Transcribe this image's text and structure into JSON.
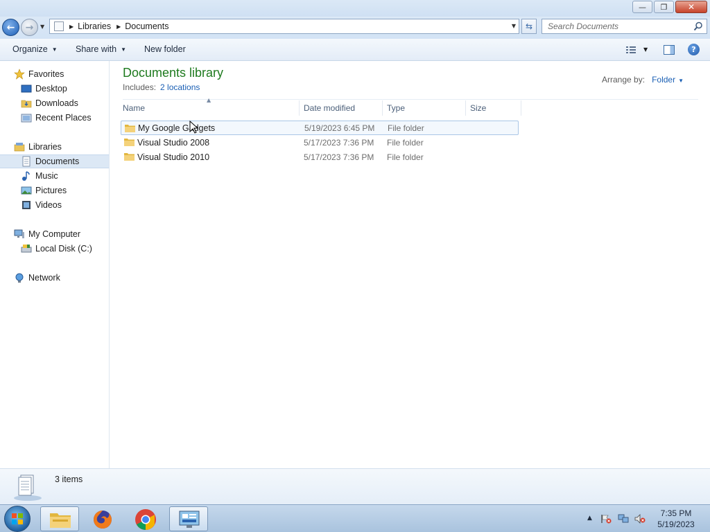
{
  "window": {
    "minimize_glyph": "—",
    "maximize_glyph": "❐",
    "close_glyph": "✕"
  },
  "address": {
    "back_glyph": "←",
    "forward_glyph": "→",
    "breadcrumbs": [
      "Libraries",
      "Documents"
    ],
    "search_placeholder": "Search Documents"
  },
  "toolbar": {
    "organize_label": "Organize",
    "share_label": "Share with",
    "new_folder_label": "New folder",
    "help_glyph": "?"
  },
  "nav": {
    "favorites": "Favorites",
    "desktop": "Desktop",
    "downloads": "Downloads",
    "recent_places": "Recent Places",
    "libraries": "Libraries",
    "documents": "Documents",
    "music": "Music",
    "pictures": "Pictures",
    "videos": "Videos",
    "my_computer": "My Computer",
    "local_disk": "Local Disk (C:)",
    "network": "Network"
  },
  "library": {
    "title": "Documents library",
    "includes_label": "Includes:",
    "locations_link": "2 locations",
    "arrange_label": "Arrange by:",
    "arrange_value": "Folder"
  },
  "columns": {
    "name": "Name",
    "date_modified": "Date modified",
    "type": "Type",
    "size": "Size"
  },
  "files": [
    {
      "name": "My Google Gadgets",
      "date": "5/19/2023 6:45 PM",
      "type": "File folder"
    },
    {
      "name": "Visual Studio 2008",
      "date": "5/17/2023 7:36 PM",
      "type": "File folder"
    },
    {
      "name": "Visual Studio 2010",
      "date": "5/17/2023 7:36 PM",
      "type": "File folder"
    }
  ],
  "status": {
    "item_count": "3 items"
  },
  "taskbar": {
    "time": "7:35 PM",
    "date": "5/19/2023"
  },
  "colors": {
    "library_title": "#1e7a1e",
    "link": "#1a5fb4",
    "selection": "#dce8f5"
  }
}
